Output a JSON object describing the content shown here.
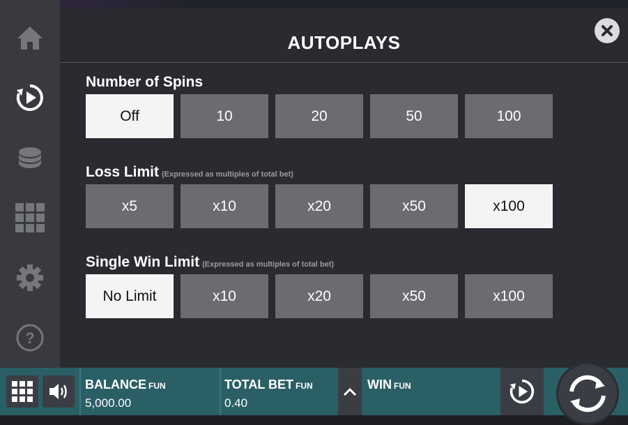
{
  "dialog": {
    "title": "AUTOPLAYS"
  },
  "sections": {
    "spins": {
      "label": "Number of Spins",
      "options": [
        "Off",
        "10",
        "20",
        "50",
        "100"
      ],
      "selected": "Off"
    },
    "loss_limit": {
      "label": "Loss Limit",
      "hint": "(Expressed as multiples of total bet)",
      "options": [
        "x5",
        "x10",
        "x20",
        "x50",
        "x100"
      ],
      "selected": "x100"
    },
    "single_win_limit": {
      "label": "Single Win Limit",
      "hint": "(Expressed as multiples of total bet)",
      "options": [
        "No Limit",
        "x10",
        "x20",
        "x50",
        "x100"
      ],
      "selected": "No Limit"
    }
  },
  "sidebar": {
    "icons": [
      "home-icon",
      "autoplay-icon",
      "coins-icon",
      "grid-icon",
      "gear-icon",
      "help-icon"
    ]
  },
  "bottom_bar": {
    "balance_label": "BALANCE",
    "balance_currency": "FUN",
    "balance_value": "5,000.00",
    "total_bet_label": "TOTAL BET",
    "total_bet_currency": "FUN",
    "total_bet_value": "0.40",
    "win_label": "WIN",
    "win_currency": "FUN"
  },
  "colors": {
    "bottom_bar": "#2b5f66",
    "option_default": "#6b6c70",
    "option_selected": "#f4f4f4"
  }
}
